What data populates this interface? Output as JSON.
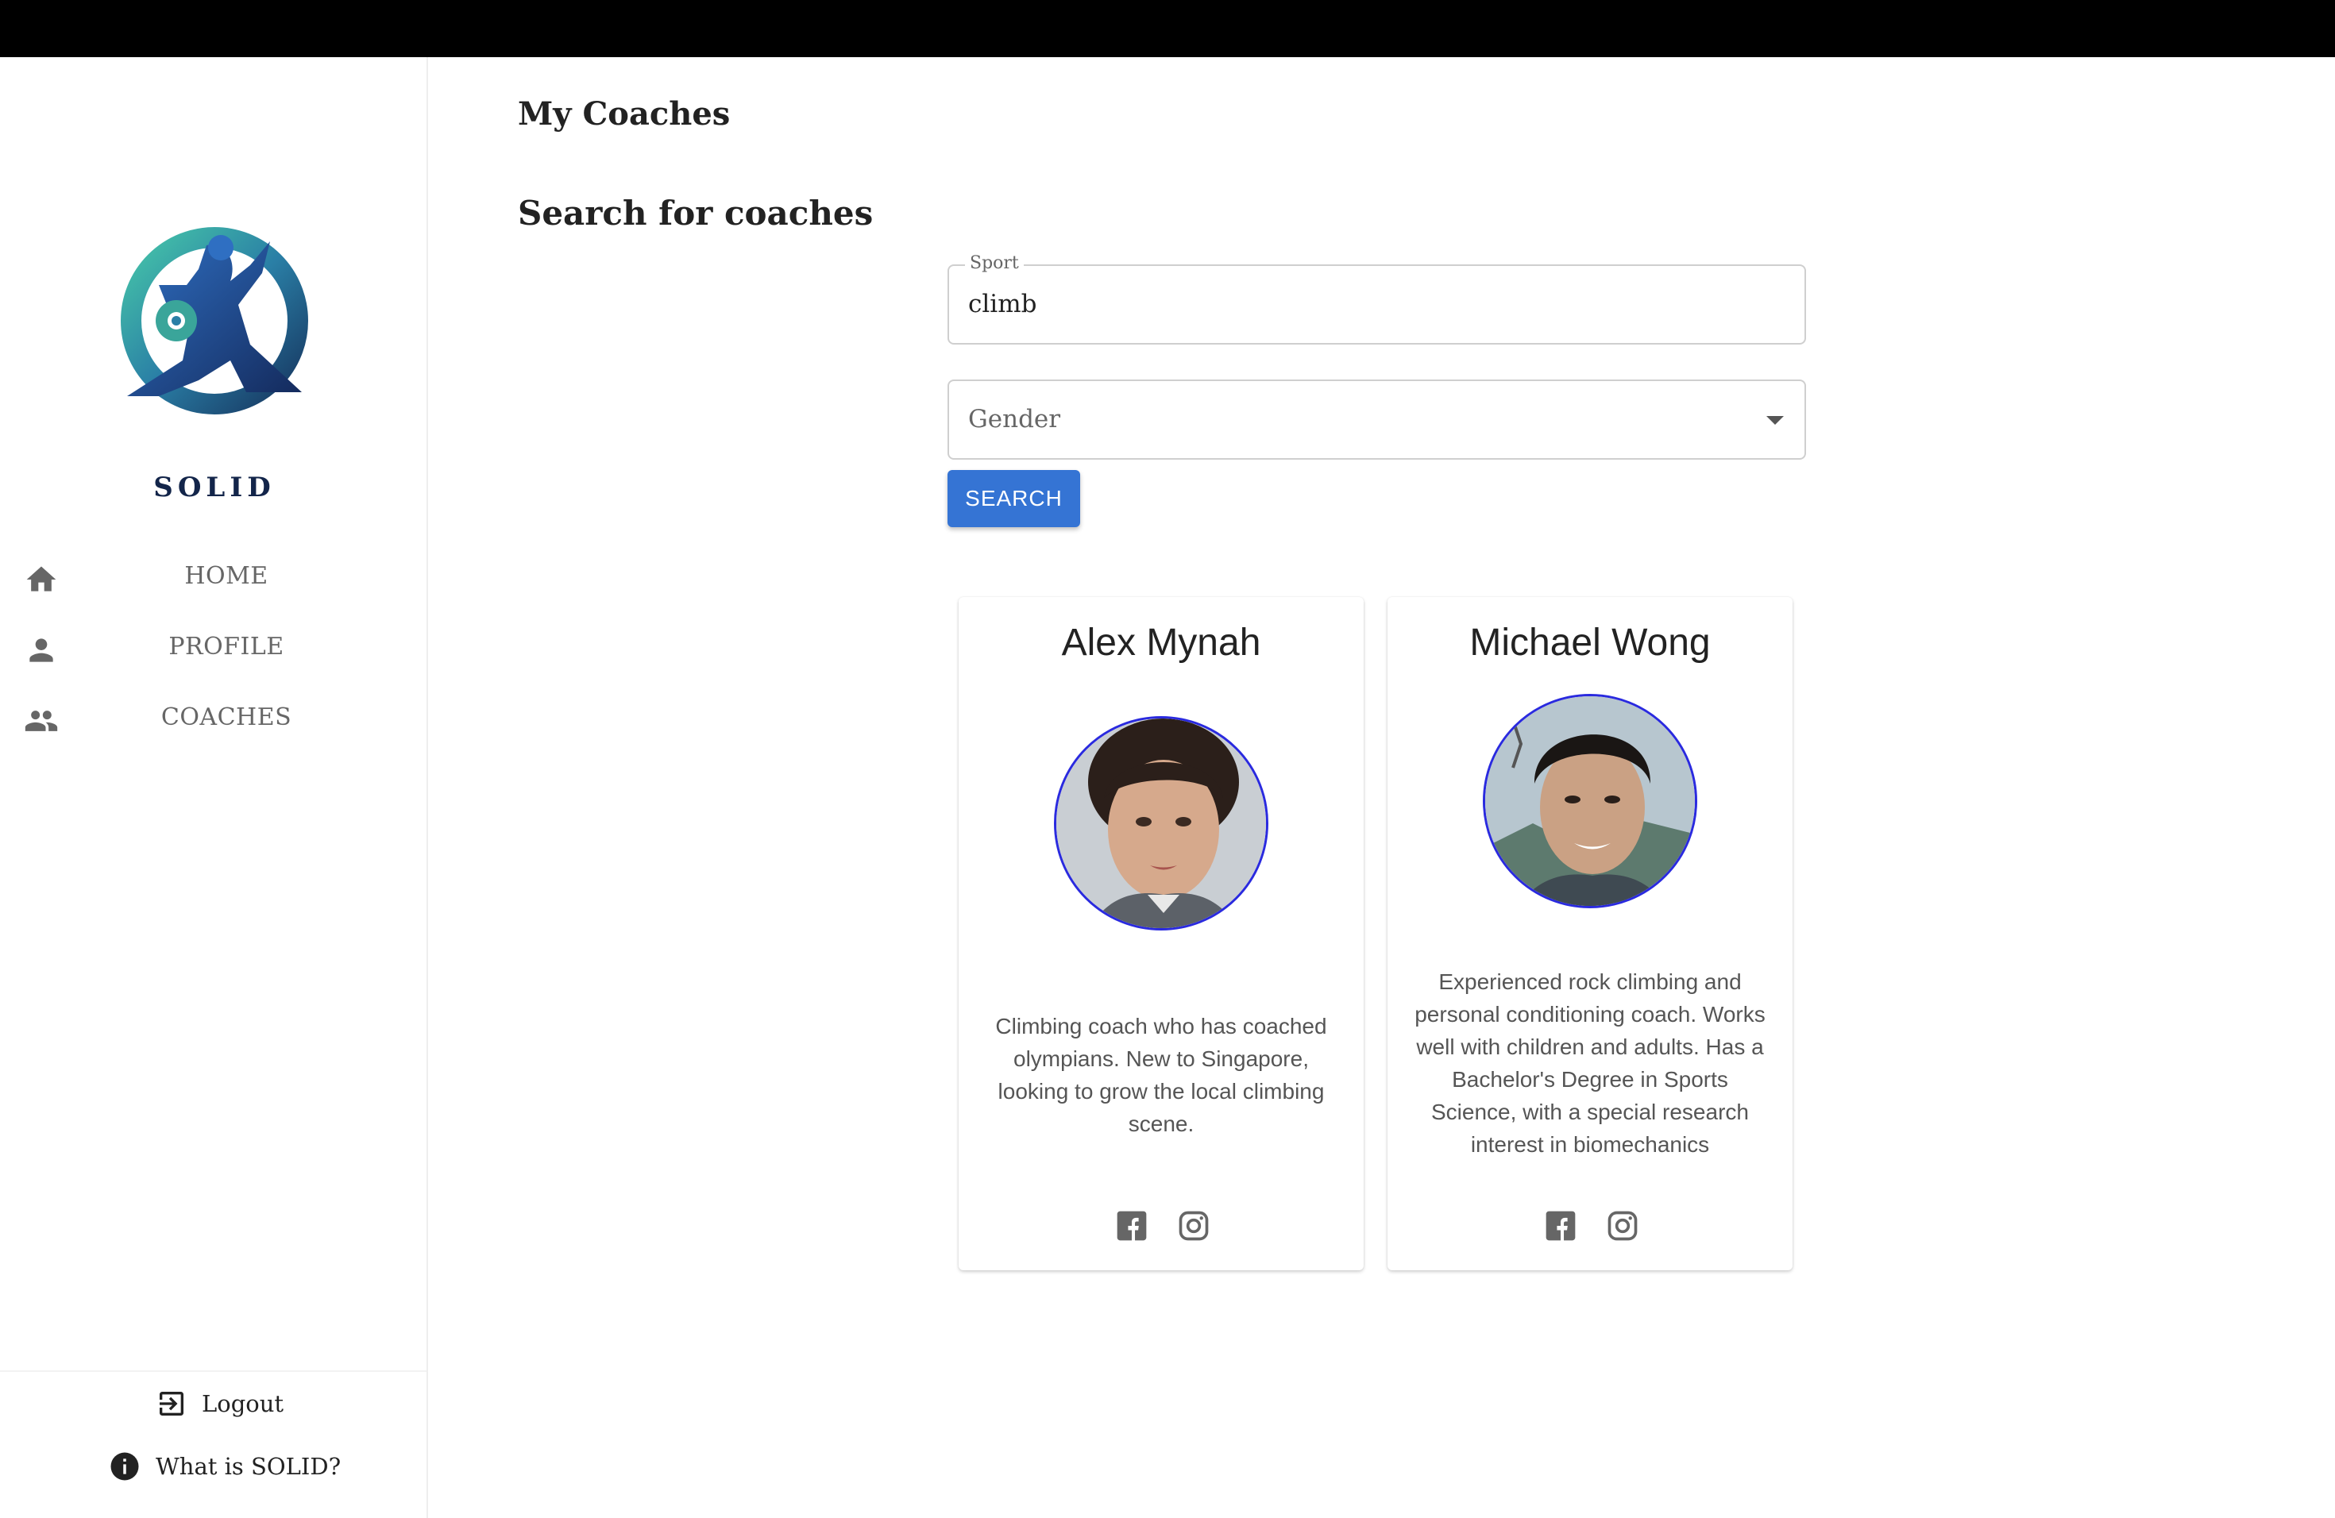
{
  "app": {
    "brand": "SOLID",
    "accent_color": "#3574d4",
    "avatar_border_color": "#2a2adf"
  },
  "sidebar": {
    "items": [
      {
        "label": "HOME",
        "icon": "home-icon"
      },
      {
        "label": "PROFILE",
        "icon": "person-icon"
      },
      {
        "label": "COACHES",
        "icon": "group-icon"
      }
    ],
    "logout_label": "Logout",
    "about_label": "What is SOLID?"
  },
  "main": {
    "title": "My Coaches",
    "search": {
      "heading": "Search for coaches",
      "sport_label": "Sport",
      "sport_value": "climb",
      "gender_placeholder": "Gender",
      "button_label": "SEARCH"
    },
    "coaches": [
      {
        "name": "Alex Mynah",
        "description": "Climbing coach who has coached olympians. New to Singapore, looking to grow the local climbing scene."
      },
      {
        "name": "Michael Wong",
        "description": "Experienced rock climbing and personal conditioning coach. Works well with children and adults. Has a Bachelor's Degree in Sports Science, with a special research interest in biomechanics"
      }
    ]
  }
}
